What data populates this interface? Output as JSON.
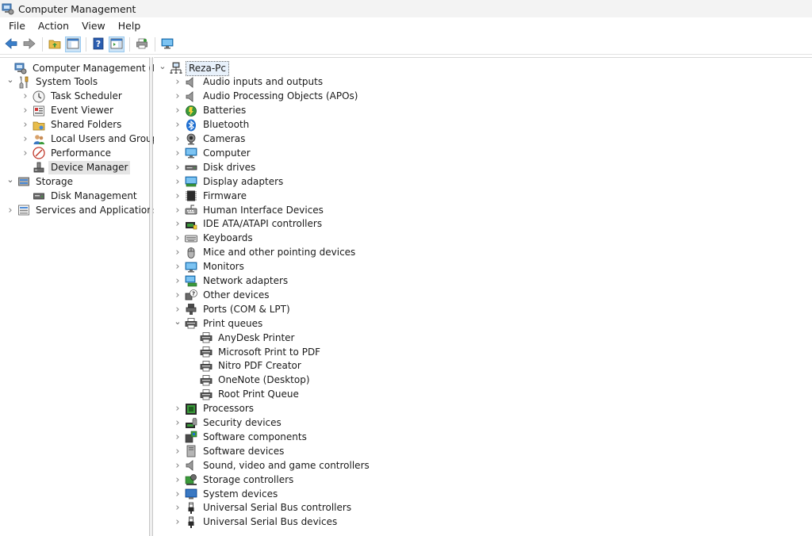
{
  "window": {
    "title": "Computer Management"
  },
  "menu": [
    {
      "id": "file",
      "label": "File"
    },
    {
      "id": "action",
      "label": "Action"
    },
    {
      "id": "view",
      "label": "View"
    },
    {
      "id": "help",
      "label": "Help"
    }
  ],
  "toolbar": {
    "buttons": [
      {
        "id": "back",
        "icon": "back-arrow-icon",
        "color": "#3a7ec9"
      },
      {
        "id": "forward",
        "icon": "forward-arrow-icon",
        "color": "#8a8a8a"
      },
      {
        "id": "up",
        "icon": "up-folder-icon",
        "color": "#d6a531"
      },
      {
        "id": "show-hide-console-tree",
        "icon": "console-tree-icon",
        "active": true
      },
      {
        "id": "help",
        "icon": "help-icon",
        "color": "#2a5db0"
      },
      {
        "id": "show-hide-action-pane",
        "icon": "action-pane-icon",
        "active": true
      },
      {
        "id": "print",
        "icon": "print-icon",
        "color": "#6a6a6a"
      },
      {
        "id": "monitor",
        "icon": "monitor-icon",
        "color": "#2b8fd6"
      }
    ]
  },
  "left_tree": [
    {
      "id": "computer-management-local",
      "label": "Computer Management (Local)",
      "icon": "computer-management-icon",
      "level": 0,
      "state": "none"
    },
    {
      "id": "system-tools",
      "label": "System Tools",
      "icon": "tools-icon",
      "level": 1,
      "state": "expanded"
    },
    {
      "id": "task-scheduler",
      "label": "Task Scheduler",
      "icon": "clock-icon",
      "level": 2,
      "state": "collapsed"
    },
    {
      "id": "event-viewer",
      "label": "Event Viewer",
      "icon": "event-viewer-icon",
      "level": 2,
      "state": "collapsed"
    },
    {
      "id": "shared-folders",
      "label": "Shared Folders",
      "icon": "shared-folder-icon",
      "level": 2,
      "state": "collapsed"
    },
    {
      "id": "local-users-and-groups",
      "label": "Local Users and Groups",
      "icon": "users-icon",
      "level": 2,
      "state": "collapsed"
    },
    {
      "id": "performance",
      "label": "Performance",
      "icon": "performance-icon",
      "level": 2,
      "state": "collapsed"
    },
    {
      "id": "device-manager",
      "label": "Device Manager",
      "icon": "device-manager-icon",
      "level": 2,
      "state": "none",
      "selected": true
    },
    {
      "id": "storage",
      "label": "Storage",
      "icon": "storage-icon",
      "level": 1,
      "state": "expanded"
    },
    {
      "id": "disk-management",
      "label": "Disk Management",
      "icon": "disk-management-icon",
      "level": 2,
      "state": "none"
    },
    {
      "id": "services-and-applications",
      "label": "Services and Applications",
      "icon": "services-icon",
      "level": 1,
      "state": "collapsed"
    }
  ],
  "device_tree": {
    "root": {
      "label": "Reza-Pc",
      "icon": "computer-network-icon"
    },
    "items": [
      {
        "id": "audio-inputs-and-outputs",
        "label": "Audio inputs and outputs",
        "icon": "speaker-icon",
        "level": 1,
        "state": "collapsed"
      },
      {
        "id": "audio-processing-objects",
        "label": "Audio Processing Objects (APOs)",
        "icon": "speaker-icon",
        "level": 1,
        "state": "collapsed"
      },
      {
        "id": "batteries",
        "label": "Batteries",
        "icon": "battery-icon",
        "level": 1,
        "state": "collapsed"
      },
      {
        "id": "bluetooth",
        "label": "Bluetooth",
        "icon": "bluetooth-icon",
        "level": 1,
        "state": "collapsed"
      },
      {
        "id": "cameras",
        "label": "Cameras",
        "icon": "camera-icon",
        "level": 1,
        "state": "collapsed"
      },
      {
        "id": "computer",
        "label": "Computer",
        "icon": "monitor-icon",
        "level": 1,
        "state": "collapsed"
      },
      {
        "id": "disk-drives",
        "label": "Disk drives",
        "icon": "disk-drive-icon",
        "level": 1,
        "state": "collapsed"
      },
      {
        "id": "display-adapters",
        "label": "Display adapters",
        "icon": "display-adapter-icon",
        "level": 1,
        "state": "collapsed"
      },
      {
        "id": "firmware",
        "label": "Firmware",
        "icon": "chip-icon",
        "level": 1,
        "state": "collapsed"
      },
      {
        "id": "human-interface-devices",
        "label": "Human Interface Devices",
        "icon": "hid-icon",
        "level": 1,
        "state": "collapsed"
      },
      {
        "id": "ide-ata-atapi-controllers",
        "label": "IDE ATA/ATAPI controllers",
        "icon": "controller-icon",
        "level": 1,
        "state": "collapsed"
      },
      {
        "id": "keyboards",
        "label": "Keyboards",
        "icon": "keyboard-icon",
        "level": 1,
        "state": "collapsed"
      },
      {
        "id": "mice-and-other-pointing-devices",
        "label": "Mice and other pointing devices",
        "icon": "mouse-icon",
        "level": 1,
        "state": "collapsed"
      },
      {
        "id": "monitors",
        "label": "Monitors",
        "icon": "monitor-icon",
        "level": 1,
        "state": "collapsed"
      },
      {
        "id": "network-adapters",
        "label": "Network adapters",
        "icon": "network-icon",
        "level": 1,
        "state": "collapsed"
      },
      {
        "id": "other-devices",
        "label": "Other devices",
        "icon": "unknown-device-icon",
        "level": 1,
        "state": "collapsed"
      },
      {
        "id": "ports-com-lpt",
        "label": "Ports (COM & LPT)",
        "icon": "port-icon",
        "level": 1,
        "state": "collapsed"
      },
      {
        "id": "print-queues",
        "label": "Print queues",
        "icon": "printer-icon",
        "level": 1,
        "state": "expanded"
      },
      {
        "id": "anydesk-printer",
        "label": "AnyDesk Printer",
        "icon": "printer-icon",
        "level": 2,
        "state": "none"
      },
      {
        "id": "microsoft-print-to-pdf",
        "label": "Microsoft Print to PDF",
        "icon": "printer-icon",
        "level": 2,
        "state": "none"
      },
      {
        "id": "nitro-pdf-creator",
        "label": "Nitro PDF Creator",
        "icon": "printer-icon",
        "level": 2,
        "state": "none"
      },
      {
        "id": "onenote-desktop",
        "label": "OneNote (Desktop)",
        "icon": "printer-icon",
        "level": 2,
        "state": "none"
      },
      {
        "id": "root-print-queue",
        "label": "Root Print Queue",
        "icon": "printer-icon",
        "level": 2,
        "state": "none"
      },
      {
        "id": "processors",
        "label": "Processors",
        "icon": "processor-icon",
        "level": 1,
        "state": "collapsed"
      },
      {
        "id": "security-devices",
        "label": "Security devices",
        "icon": "security-icon",
        "level": 1,
        "state": "collapsed"
      },
      {
        "id": "software-components",
        "label": "Software components",
        "icon": "software-component-icon",
        "level": 1,
        "state": "collapsed"
      },
      {
        "id": "software-devices",
        "label": "Software devices",
        "icon": "software-device-icon",
        "level": 1,
        "state": "collapsed"
      },
      {
        "id": "sound-video-and-game-controllers",
        "label": "Sound, video and game controllers",
        "icon": "speaker-icon",
        "level": 1,
        "state": "collapsed"
      },
      {
        "id": "storage-controllers",
        "label": "Storage controllers",
        "icon": "storage-controller-icon",
        "level": 1,
        "state": "collapsed"
      },
      {
        "id": "system-devices",
        "label": "System devices",
        "icon": "system-device-icon",
        "level": 1,
        "state": "collapsed"
      },
      {
        "id": "usb-controllers",
        "label": "Universal Serial Bus controllers",
        "icon": "usb-icon",
        "level": 1,
        "state": "collapsed"
      },
      {
        "id": "usb-devices",
        "label": "Universal Serial Bus devices",
        "icon": "usb-icon",
        "level": 1,
        "state": "collapsed"
      }
    ]
  }
}
